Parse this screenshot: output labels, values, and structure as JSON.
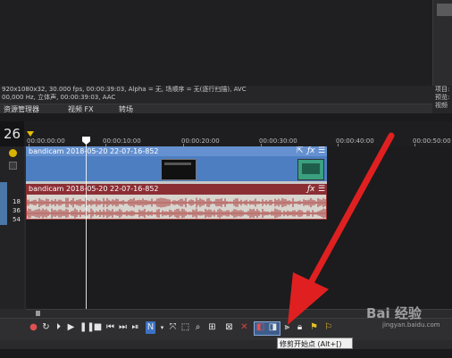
{
  "info": {
    "line1": "920x1080x32, 30.000 fps, 00:00:39:03, Alpha = 无, 场顺序 = 无(逐行扫描), AVC",
    "line2": "00,000 Hz, 立体声, 00:00:39:03, AAC",
    "right_line1": "项目:",
    "right_line2": "预览:"
  },
  "tabs": [
    {
      "label": "资源管理器"
    },
    {
      "label": "视频 FX"
    },
    {
      "label": "转场"
    }
  ],
  "right_tab": "视频",
  "time_display": "26",
  "ruler": {
    "labels": [
      "00:00:00:00",
      "00:00:10:00",
      "00:00:20:00",
      "00:00:30:00",
      "00:00:40:00",
      "00:00:50:00"
    ]
  },
  "tracks": {
    "video": {
      "title": "bandicam 2018-05-20 22-07-16-852",
      "color": "#4d7ec2"
    },
    "audio": {
      "title": "bandicam 2018-05-20 22-07-16-852",
      "color": "#8b2e34"
    }
  },
  "volume_labels": [
    "18",
    "36",
    "54"
  ],
  "tooltip": "修剪开始点 (Alt+[)",
  "watermark": {
    "text": "Bai 经验",
    "sub": "jingyan.baidu.com"
  },
  "icons": [
    "record-icon",
    "loop-icon",
    "play-from-start-icon",
    "play-icon",
    "pause-icon",
    "stop-icon",
    "prev-frame-icon",
    "next-frame-icon",
    "go-end-icon",
    "normal-edit-tool-icon",
    "envelope-tool-icon",
    "selection-tool-icon",
    "zoom-tool-icon",
    "delete-icon",
    "trim-start-icon",
    "trim-end-icon",
    "split-icon",
    "lock-icon",
    "marker-icon",
    "region-icon"
  ],
  "colors": {
    "accent": "#e02020",
    "selected": "#3d5e8c"
  }
}
